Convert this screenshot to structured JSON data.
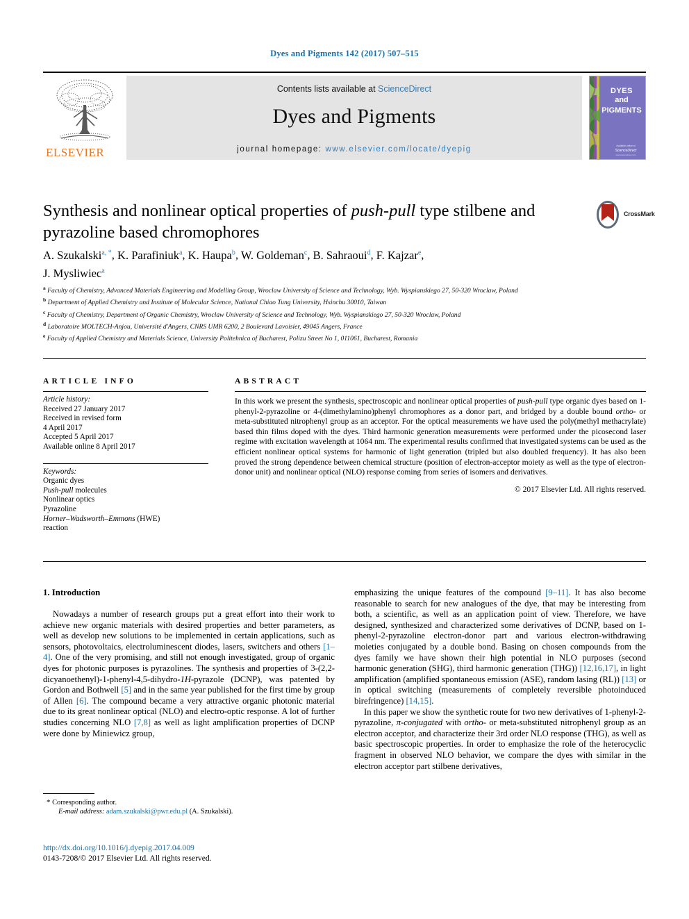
{
  "running_head": "Dyes and Pigments 142 (2017) 507–515",
  "masthead": {
    "publisher_name": "ELSEVIER",
    "contents_prefix": "Contents lists available at ",
    "contents_link": "ScienceDirect",
    "journal_title": "Dyes and Pigments",
    "homepage_prefix": "journal homepage: ",
    "homepage_url": "www.elsevier.com/locate/dyepig",
    "cover_line1": "DYES",
    "cover_line2": "and",
    "cover_line3": "PIGMENTS",
    "cover_footer": "Available at\nScienceDirect"
  },
  "article": {
    "title_part1": "Synthesis and nonlinear optical properties of ",
    "title_italic": "push-pull",
    "title_part2": " type stilbene and pyrazoline based chromophores",
    "crossmark_label": "CrossMark",
    "authors": [
      {
        "name": "A. Szukalski",
        "sup": "a, *"
      },
      {
        "name": "K. Parafiniuk",
        "sup": "a"
      },
      {
        "name": "K. Haupa",
        "sup": "b"
      },
      {
        "name": "W. Goldeman",
        "sup": "c"
      },
      {
        "name": "B. Sahraoui",
        "sup": "d"
      },
      {
        "name": "F. Kajzar",
        "sup": "e"
      },
      {
        "name": "J. Mysliwiec",
        "sup": "a"
      }
    ],
    "affiliations": [
      {
        "marker": "a",
        "text": "Faculty of Chemistry, Advanced Materials Engineering and Modelling Group, Wroclaw University of Science and Technology, Wyb. Wyspianskiego 27, 50-320 Wroclaw, Poland"
      },
      {
        "marker": "b",
        "text": "Department of Applied Chemistry and Institute of Molecular Science, National Chiao Tung University, Hsinchu 30010, Taiwan"
      },
      {
        "marker": "c",
        "text": "Faculty of Chemistry, Department of Organic Chemistry, Wroclaw University of Science and Technology, Wyb. Wyspianskiego 27, 50-320 Wroclaw, Poland"
      },
      {
        "marker": "d",
        "text": "Laboratoire MOLTECH-Anjou, Université d'Angers, CNRS UMR 6200, 2 Boulevard Lavoisier, 49045 Angers, France"
      },
      {
        "marker": "e",
        "text": "Faculty of Applied Chemistry and Materials Science, University Politehnica of Bucharest, Polizu Street No 1, 011061, Bucharest, Romania"
      }
    ]
  },
  "article_info": {
    "heading": "ARTICLE INFO",
    "history_label": "Article history:",
    "history": [
      "Received 27 January 2017",
      "Received in revised form",
      "4 April 2017",
      "Accepted 5 April 2017",
      "Available online 8 April 2017"
    ],
    "keywords_label": "Keywords:",
    "keywords": [
      "Organic dyes",
      "Push-pull molecules",
      "Nonlinear optics",
      "Pyrazoline",
      "Horner–Wadsworth–Emmons (HWE)",
      "reaction"
    ]
  },
  "abstract": {
    "heading": "ABSTRACT",
    "body": "In this work we present the synthesis, spectroscopic and nonlinear optical properties of push-pull type organic dyes based on 1-phenyl-2-pyrazoline or 4-(dimethylamino)phenyl chromophores as a donor part, and bridged by a double bound ortho- or meta-substituted nitrophenyl group as an acceptor. For the optical measurements we have used the poly(methyl methacrylate) based thin films doped with the dyes. Third harmonic generation measurements were performed under the picosecond laser regime with excitation wavelength at 1064 nm. The experimental results confirmed that investigated systems can be used as the efficient nonlinear optical systems for harmonic of light generation (tripled but also doubled frequency). It has also been proved the strong dependence between chemical structure (position of electron-acceptor moiety as well as the type of electron-donor unit) and nonlinear optical (NLO) response coming from series of isomers and derivatives.",
    "copyright": "© 2017 Elsevier Ltd. All rights reserved."
  },
  "body": {
    "section_heading": "1. Introduction",
    "left_paragraph": "Nowadays a number of research groups put a great effort into their work to achieve new organic materials with desired properties and better parameters, as well as develop new solutions to be implemented in certain applications, such as sensors, photovoltaics, electroluminescent diodes, lasers, switchers and others [1–4]. One of the very promising, and still not enough investigated, group of organic dyes for photonic purposes is pyrazolines. The synthesis and properties of 3-(2,2-dicyanoethenyl)-1-phenyl-4,5-dihydro-1H-pyrazole (DCNP), was patented by Gordon and Bothwell [5] and in the same year published for the first time by group of Allen [6]. The compound became a very attractive organic photonic material due to its great nonlinear optical (NLO) and electro-optic response. A lot of further studies concerning NLO [7,8] as well as light amplification properties of DCNP were done by Miniewicz group,",
    "right_paragraph_1": "emphasizing the unique features of the compound [9–11]. It has also become reasonable to search for new analogues of the dye, that may be interesting from both, a scientific, as well as an application point of view. Therefore, we have designed, synthesized and characterized some derivatives of DCNP, based on 1-phenyl-2-pyrazoline electron-donor part and various electron-withdrawing moieties conjugated by a double bond. Basing on chosen compounds from the dyes family we have shown their high potential in NLO purposes (second harmonic generation (SHG), third harmonic generation (THG)) [12,16,17], in light amplification (amplified spontaneous emission (ASE), random lasing (RL)) [13] or in optical switching (measurements of completely reversible photoinduced birefringence) [14,15].",
    "right_paragraph_2": "In this paper we show the synthetic route for two new derivatives of 1-phenyl-2-pyrazoline, π-conjugated with ortho- or meta-substituted nitrophenyl group as an electron acceptor, and characterize their 3rd order NLO response (THG), as well as basic spectroscopic properties. In order to emphasize the role of the heterocyclic fragment in observed NLO behavior, we compare the dyes with similar in the electron acceptor part stilbene derivatives,"
  },
  "footnote": {
    "corresponding": "Corresponding author.",
    "email_label": "E-mail address:",
    "email": "adam.szukalski@pwr.edu.pl",
    "email_suffix": "(A. Szukalski)."
  },
  "footer": {
    "doi": "http://dx.doi.org/10.1016/j.dyepig.2017.04.009",
    "issn": "0143-7208/© 2017 Elsevier Ltd. All rights reserved."
  },
  "colors": {
    "link_blue": "#1a6fa8",
    "elsevier_orange": "#E87722",
    "masthead_grey": "#e4e4e4",
    "cover_purple": "#7a74c0"
  }
}
